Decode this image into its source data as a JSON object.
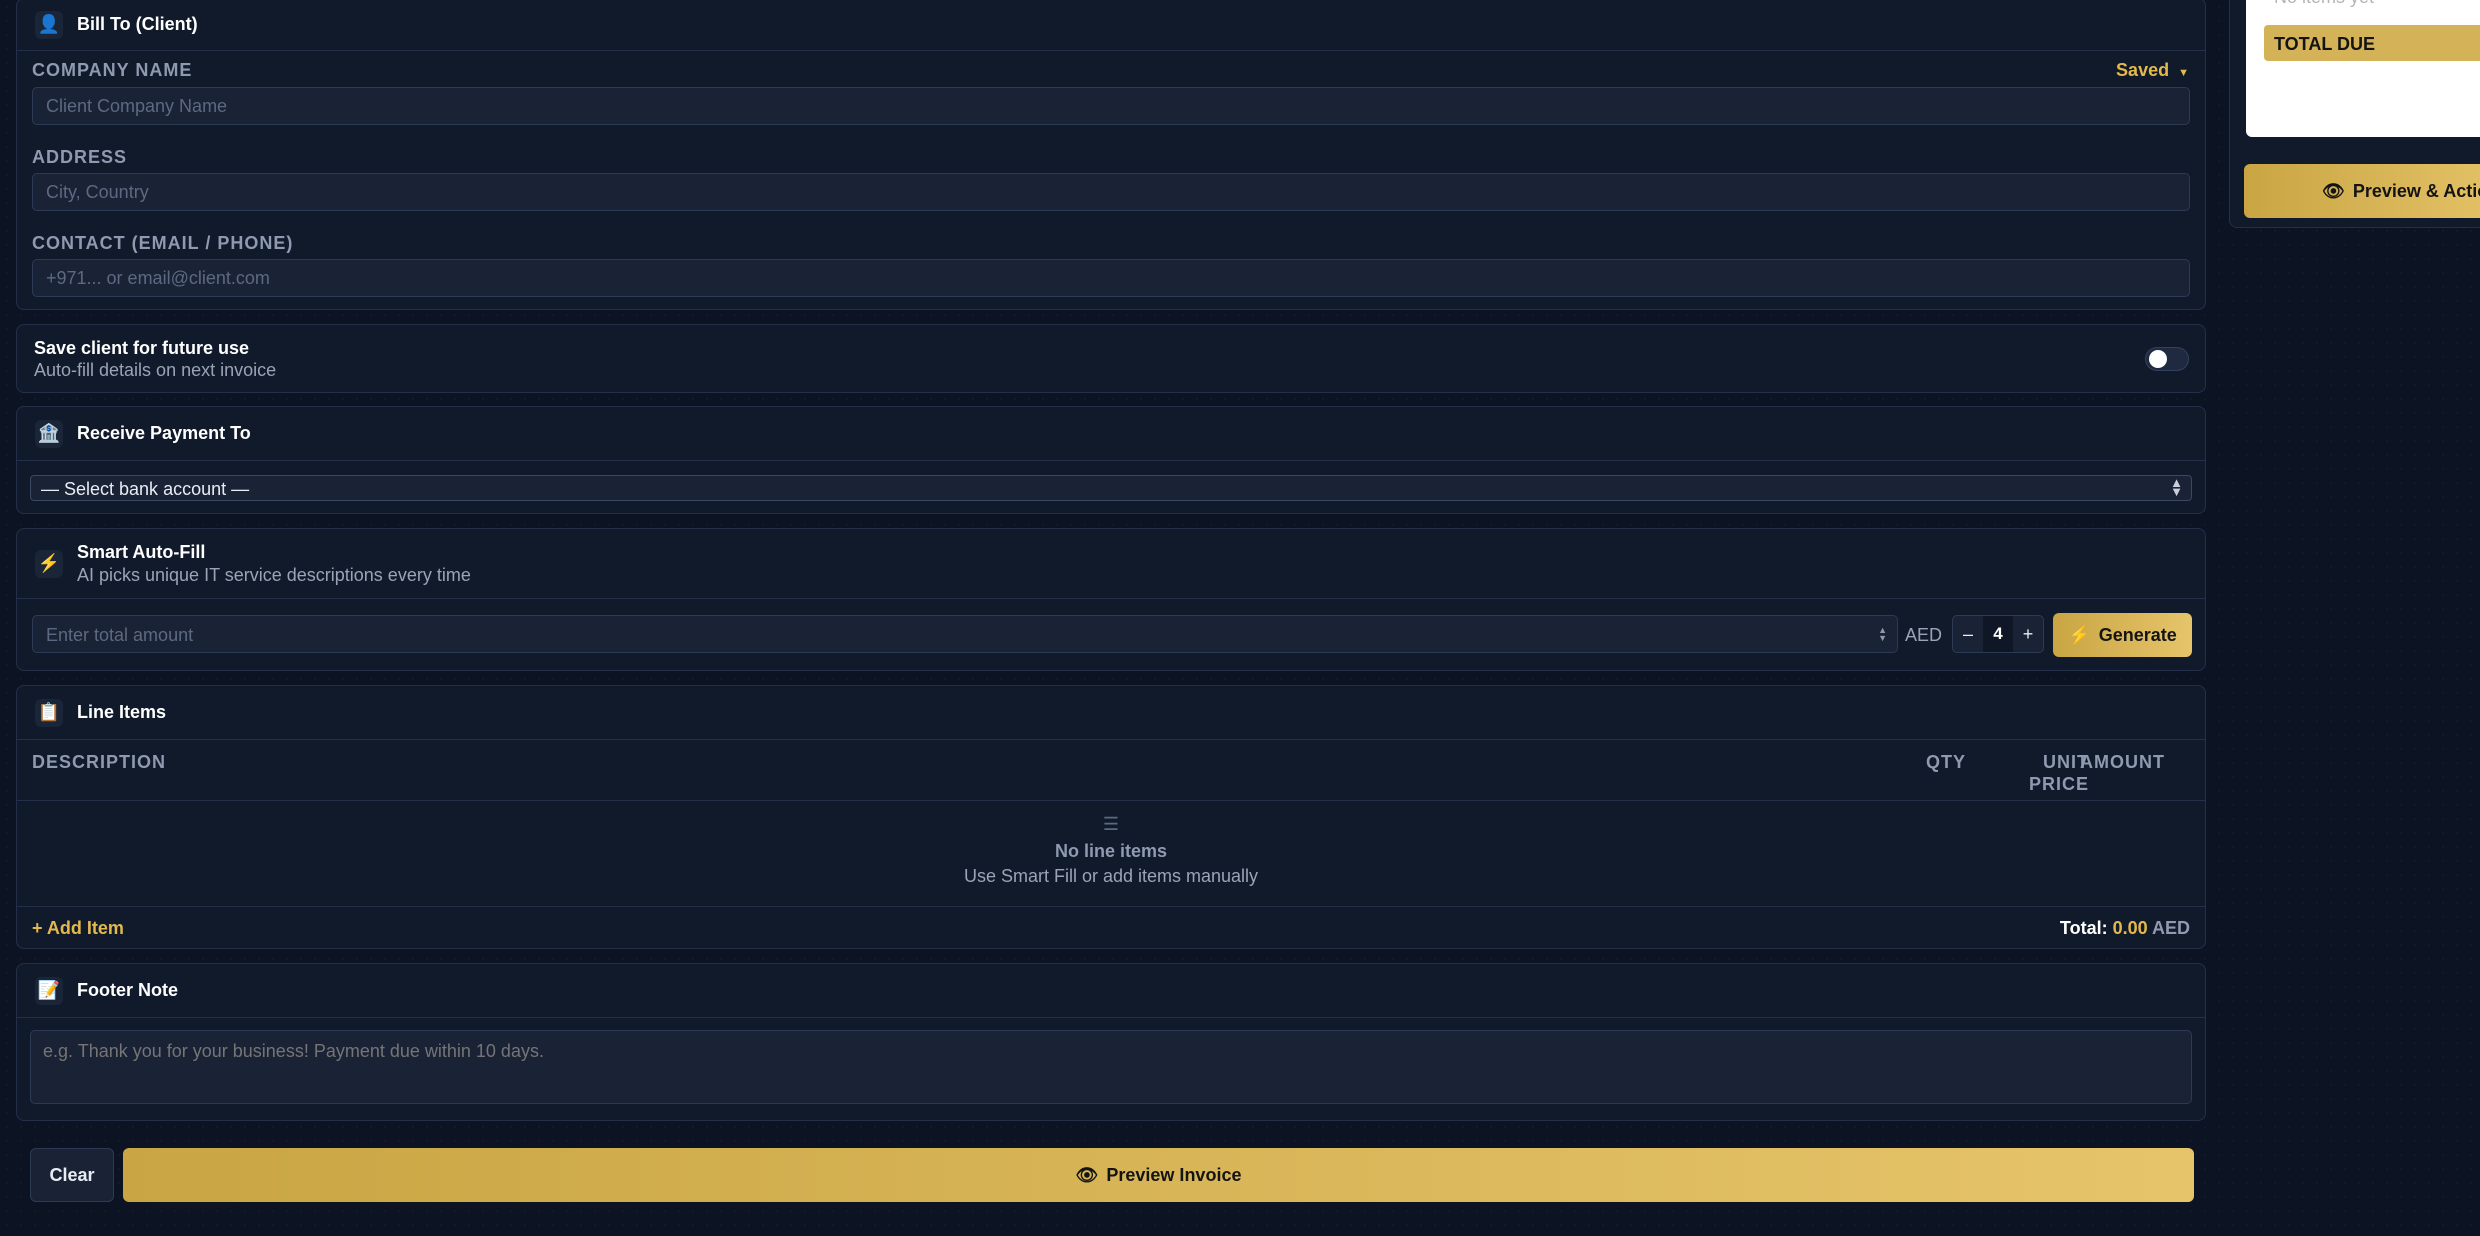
{
  "bill_to": {
    "title": "Bill To (Client)",
    "icon": "user-icon",
    "saved_label": "Saved",
    "company_label": "COMPANY NAME",
    "company_placeholder": "Client Company Name",
    "address_label": "ADDRESS",
    "address_placeholder": "City, Country",
    "contact_label": "CONTACT (EMAIL / PHONE)",
    "contact_placeholder": "+971... or email@client.com"
  },
  "save_client": {
    "title": "Save client for future use",
    "subtitle": "Auto-fill details on next invoice",
    "enabled": false
  },
  "payment": {
    "title": "Receive Payment To",
    "icon": "bank-icon",
    "select_value": "— Select bank account —"
  },
  "smart_fill": {
    "title": "Smart Auto-Fill",
    "subtitle": "AI picks unique IT service descriptions every time",
    "icon": "lightning-icon",
    "amount_placeholder": "Enter total amount",
    "currency": "AED",
    "minus": "–",
    "count": "4",
    "plus": "+",
    "generate_label": "Generate"
  },
  "line_items": {
    "title": "Line Items",
    "icon": "clipboard-icon",
    "columns": {
      "description": "DESCRIPTION",
      "qty": "QTY",
      "unit_price_1": "UNIT",
      "unit_price_2": "PRICE",
      "amount": "AMOUNT"
    },
    "empty_title": "No line items",
    "empty_sub": "Use Smart Fill or add items manually",
    "add_item": "+ Add Item",
    "total_label": "Total:",
    "total_value": "0.00",
    "total_currency": "AED"
  },
  "footer_note": {
    "title": "Footer Note",
    "icon": "memo-icon",
    "placeholder": "e.g. Thank you for your business! Payment due within 10 days."
  },
  "actions": {
    "clear": "Clear",
    "preview": "Preview Invoice"
  },
  "side_panel": {
    "faded_text": "No items yet",
    "total_due": "TOTAL DUE",
    "preview_actions": "Preview & Actions"
  },
  "colors": {
    "accent": "#e3b94c",
    "background": "#0c1322",
    "card": "#111a2b"
  }
}
